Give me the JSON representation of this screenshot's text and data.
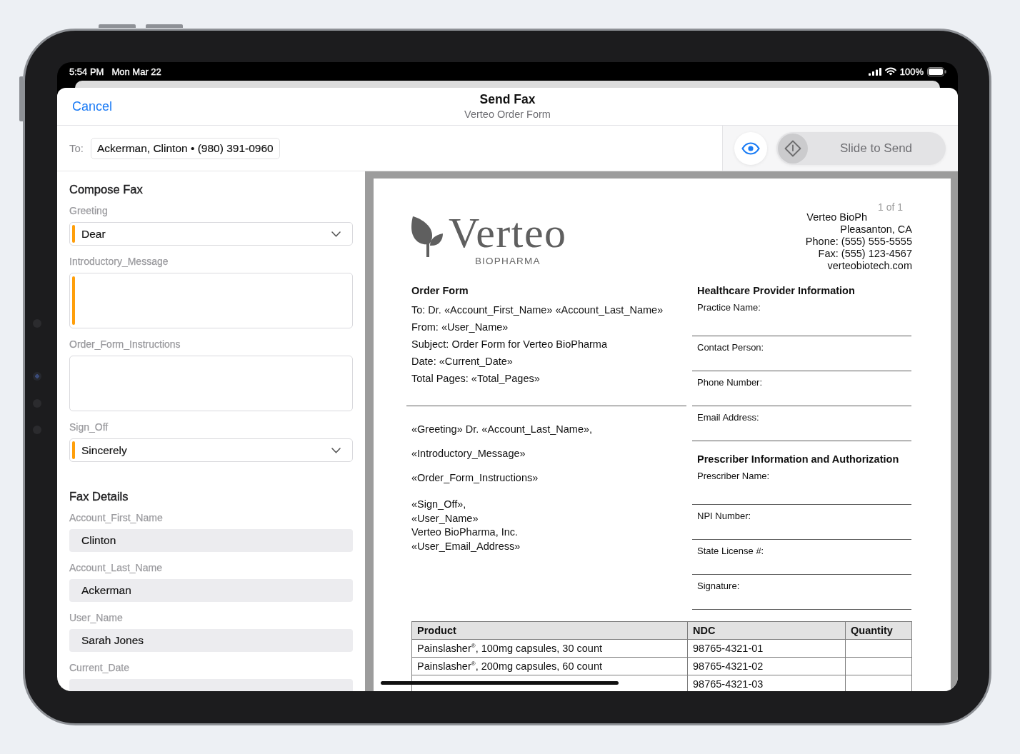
{
  "status_bar": {
    "time": "5:54 PM",
    "date": "Mon Mar 22",
    "battery": "100%"
  },
  "header": {
    "cancel": "Cancel",
    "title": "Send Fax",
    "subtitle": "Verteo Order Form"
  },
  "recipient": {
    "label": "To:",
    "token": "Ackerman, Clinton • (980) 391-0960"
  },
  "send": {
    "label": "Slide to Send",
    "level": 0
  },
  "sections": [
    {
      "title": "Compose Fax",
      "fields": [
        {
          "kind": "select",
          "label": "Greeting",
          "value": "Dear",
          "required": true
        },
        {
          "kind": "textarea",
          "label": "Introductory_Message",
          "required": true
        },
        {
          "kind": "textarea",
          "label": "Order_Form_Instructions",
          "required": false
        },
        {
          "kind": "select",
          "label": "Sign_Off",
          "value": "Sincerely",
          "required": true
        }
      ]
    },
    {
      "title": "Fax Details",
      "fields": [
        {
          "kind": "text",
          "label": "Account_First_Name",
          "value": "Clinton",
          "required": false
        },
        {
          "kind": "text",
          "label": "Account_Last_Name",
          "value": "Ackerman",
          "required": false
        },
        {
          "kind": "text",
          "label": "User_Name",
          "value": "Sarah Jones",
          "required": false
        },
        {
          "kind": "text",
          "label": "Current_Date",
          "required": false
        }
      ]
    }
  ],
  "document": {
    "page_indicator": "1 of 1",
    "logo": {
      "wordmark": "Verteo",
      "tagline": "BIOPHARMA"
    },
    "address": [
      "Verteo BioPh",
      "Pleasanton, CA",
      "Phone: (555) 555-5555",
      "Fax: (555) 123-4567",
      "verteobiotech.com"
    ],
    "order": {
      "title": "Order Form",
      "lines": [
        "To: Dr. «Account_First_Name» «Account_Last_Name»",
        "From: «User_Name»",
        "Subject: Order Form for Verteo BioPharma",
        "Date: «Current_Date»",
        "Total Pages: «Total_Pages»"
      ]
    },
    "letter": [
      [
        "«Greeting» Dr. «Account_Last_Name»,"
      ],
      [
        "«Introductory_Message»"
      ],
      [
        "«Order_Form_Instructions»"
      ],
      [
        "«Sign_Off»,",
        "«User_Name»",
        "Verteo BioPharma, Inc.",
        "«User_Email_Address»"
      ]
    ],
    "forms": [
      {
        "title": "Healthcare Provider Information",
        "fields": [
          "Practice Name:",
          "Contact Person:",
          "Phone Number:",
          "Email Address:"
        ]
      },
      {
        "title": "Prescriber Information and Authorization",
        "fields": [
          "Prescriber Name:",
          "NPI Number:",
          "State License #:",
          "Signature:"
        ]
      }
    ],
    "table": {
      "columns": [
        "Product",
        "NDC",
        "Quantity"
      ],
      "rows": [
        {
          "product": "Painslasher$^{®}$, 100mg capsules, 30 count",
          "ndc": "98765-4321-01"
        },
        {
          "product": "Painslasher$^{®}$, 200mg capsules, 60 count",
          "ndc": "98765-4321-02"
        },
        {
          "ndc": "98765-4321-03"
        }
      ]
    }
  }
}
